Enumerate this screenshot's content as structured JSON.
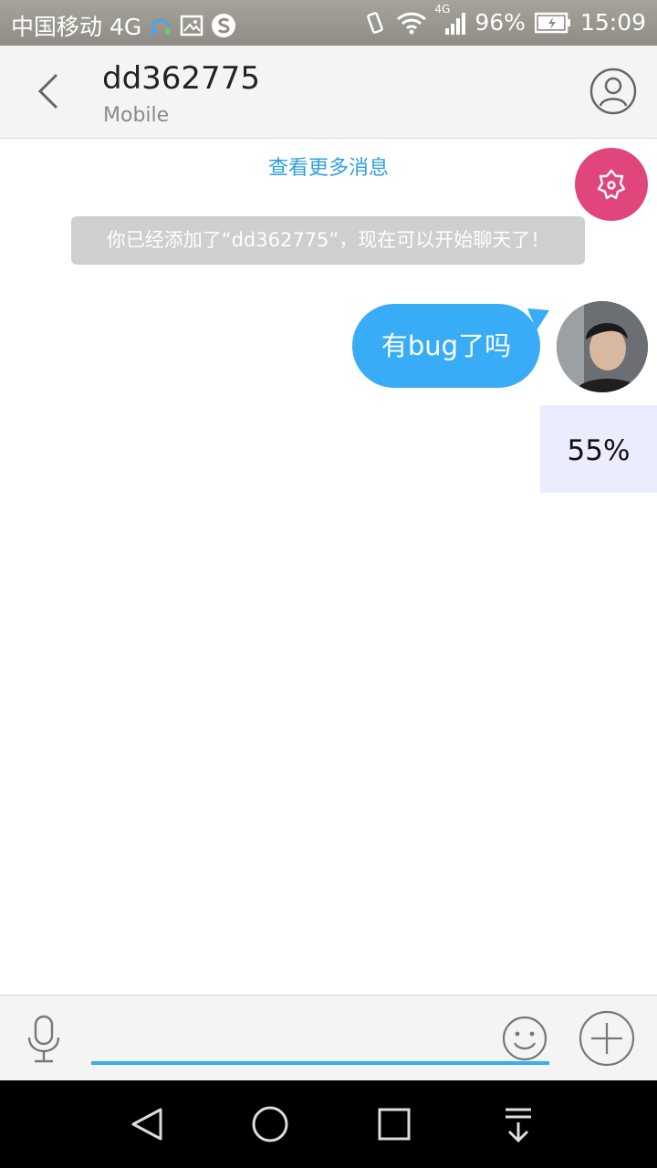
{
  "status_bar": {
    "carrier": "中国移动 4G",
    "battery": "96%",
    "time": "15:09",
    "network_small": "4G"
  },
  "header": {
    "title": "dd362775",
    "subtitle": "Mobile"
  },
  "chat": {
    "load_more": "查看更多消息",
    "system_message": "你已经添加了“dd362775”，现在可以开始聊天了！",
    "messages": [
      {
        "text": "有bug了吗",
        "sender": "me"
      }
    ],
    "progress_label": "55%"
  },
  "input_bar": {
    "value": "",
    "placeholder": ""
  },
  "icons": {
    "back": "back-chevron-icon",
    "profile": "person-icon",
    "fab": "flower-icon",
    "mic": "microphone-icon",
    "emoji": "smiley-icon",
    "plus": "plus-icon",
    "nav_back": "triangle-back-icon",
    "nav_home": "circle-home-icon",
    "nav_recent": "square-recent-icon",
    "nav_notifications": "pull-down-icon"
  },
  "colors": {
    "accent": "#39acf7",
    "fab": "#e0457c",
    "system_message_bg": "#cfcfcf",
    "progress_bg": "#ececff"
  }
}
